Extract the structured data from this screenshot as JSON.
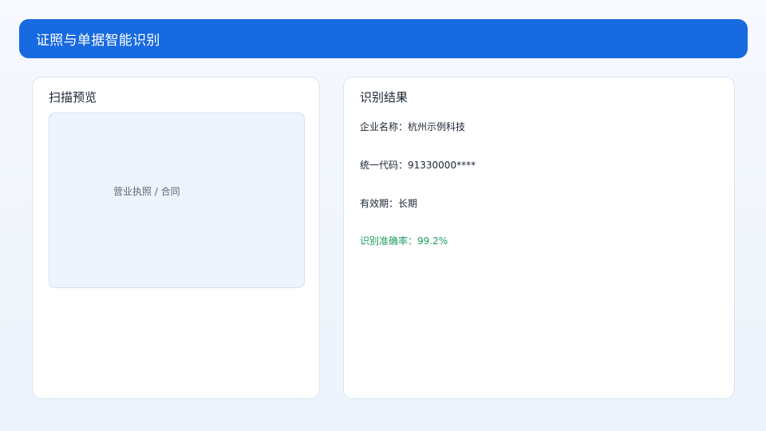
{
  "header": {
    "title": "证照与单据智能识别"
  },
  "preview": {
    "title": "扫描预览",
    "placeholder": "营业执照 / 合同"
  },
  "result": {
    "title": "识别结果",
    "rows": [
      {
        "text": "企业名称：杭州示例科技"
      },
      {
        "text": "统一代码：91330000****"
      },
      {
        "text": "有效期：长期"
      },
      {
        "text": "识别准确率：99.2%"
      }
    ],
    "accuracy_color": "#1f9c5f"
  },
  "colors": {
    "brand": "#176ae0",
    "background": "#f6f9fe"
  }
}
